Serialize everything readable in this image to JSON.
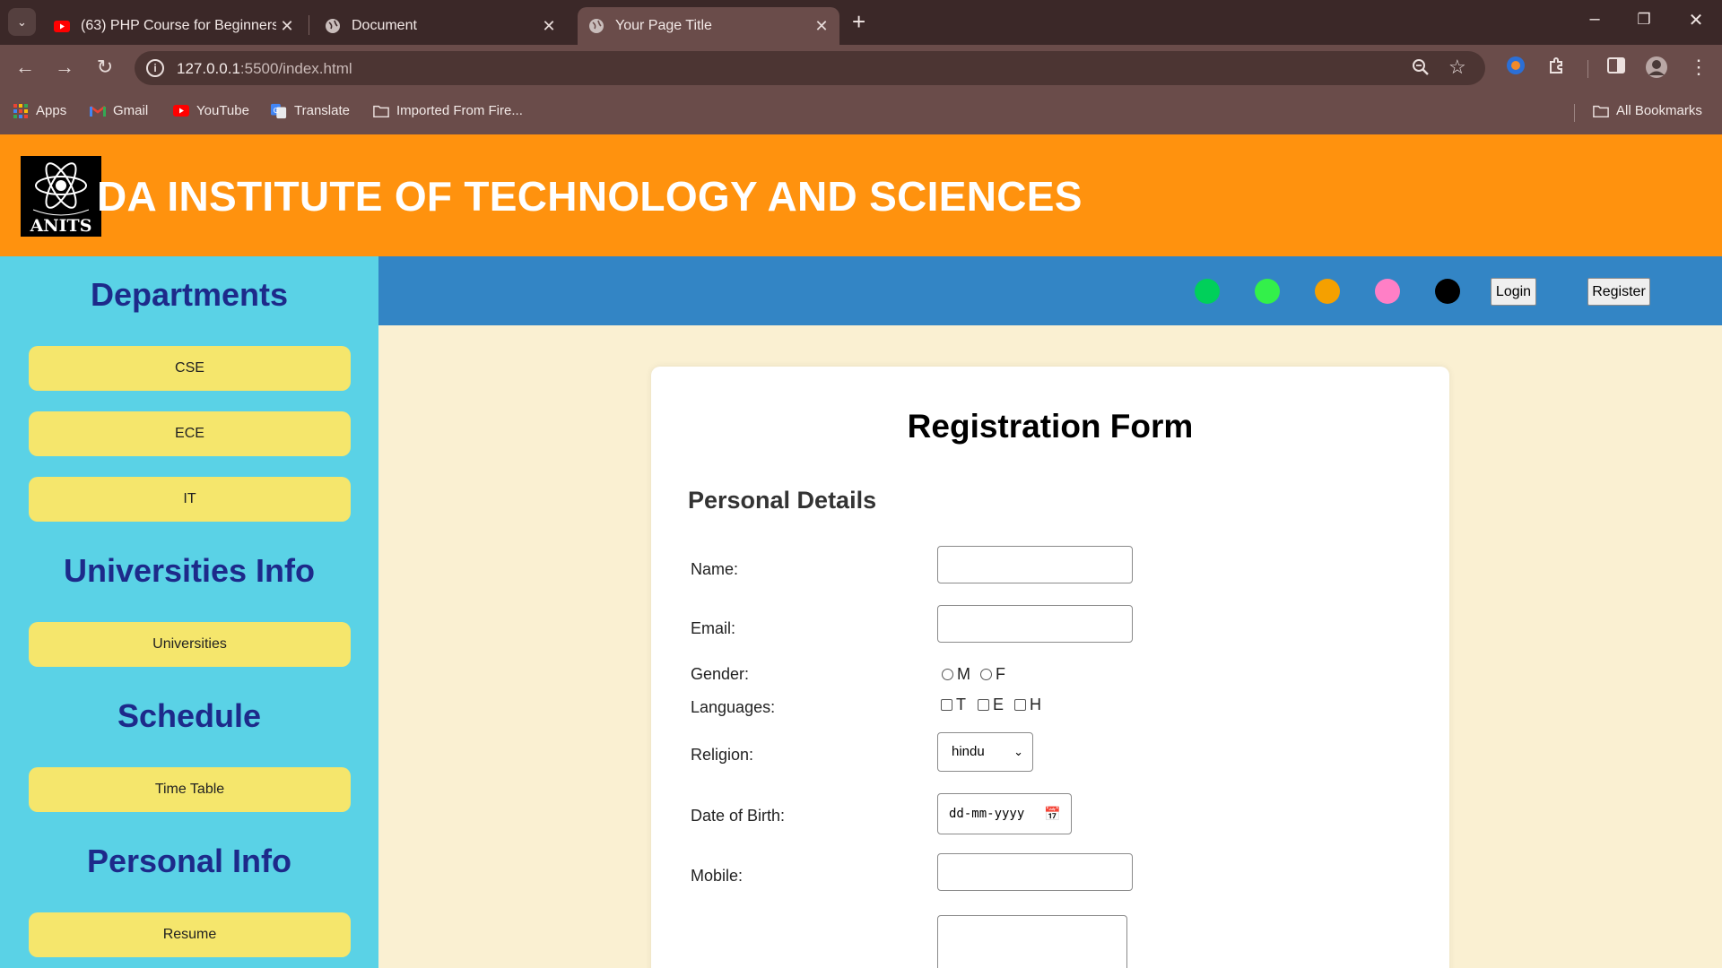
{
  "browser": {
    "tabs": [
      {
        "title": "(63) PHP Course for Beginners -",
        "favicon": "youtube-icon"
      },
      {
        "title": "Document",
        "favicon": "globe-icon"
      },
      {
        "title": "Your Page Title",
        "favicon": "globe-icon",
        "active": true
      }
    ],
    "url_host": "127.0.0.1",
    "url_path": ":5500/index.html",
    "bookmarks": [
      {
        "label": "Apps",
        "icon": "apps-grid-icon"
      },
      {
        "label": "Gmail",
        "icon": "gmail-icon"
      },
      {
        "label": "YouTube",
        "icon": "youtube-icon"
      },
      {
        "label": "Translate",
        "icon": "translate-icon"
      },
      {
        "label": "Imported From Fire...",
        "icon": "folder-icon"
      }
    ],
    "all_bookmarks": "All Bookmarks"
  },
  "site": {
    "title": "DA INSTITUTE OF TECHNOLOGY AND SCIENCES",
    "logo_text": "ANITS",
    "header_color": "#ff920e"
  },
  "sidebar": {
    "headings": [
      "Departments",
      "Universities Info",
      "Schedule",
      "Personal Info"
    ],
    "buttons": [
      "CSE",
      "ECE",
      "IT",
      "Universities",
      "Time Table",
      "Resume"
    ]
  },
  "navbar": {
    "theme_dots": [
      "#00d05a",
      "#33f04a",
      "#f5a000",
      "#ff7fc6",
      "#000000"
    ],
    "login": "Login",
    "register": "Register"
  },
  "form": {
    "title": "Registration Form",
    "section": "Personal Details",
    "labels": {
      "name": "Name:",
      "email": "Email:",
      "gender": "Gender:",
      "languages": "Languages:",
      "religion": "Religion:",
      "dob": "Date of Birth:",
      "mobile": "Mobile:"
    },
    "gender_options": [
      "M",
      "F"
    ],
    "language_options": [
      "T",
      "E",
      "H"
    ],
    "religion_selected": "hindu",
    "dob_placeholder": "dd-mm-yyyy"
  }
}
